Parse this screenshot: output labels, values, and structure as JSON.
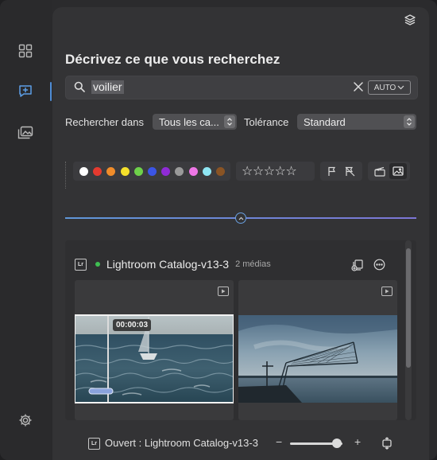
{
  "search": {
    "title": "Décrivez ce que vous recherchez",
    "query": "voilier",
    "auto_label": "AUTO"
  },
  "filters": {
    "search_in_label": "Rechercher dans",
    "search_in_value": "Tous les ca...",
    "tolerance_label": "Tolérance",
    "tolerance_value": "Standard",
    "colors": [
      "#ffffff",
      "#e53a2f",
      "#f08c2a",
      "#f5e02b",
      "#6ed14a",
      "#3b55e6",
      "#8f2bd6",
      "#9a9a9a",
      "#ee77e6",
      "#8fe6f3",
      "#8a5424"
    ],
    "stars": [
      "☆",
      "☆",
      "☆",
      "☆",
      "☆"
    ]
  },
  "results": {
    "catalog_badge": "Lr",
    "catalog_name": "Lightroom Catalog-v13-3",
    "media_count": "2 médias",
    "items": [
      {
        "timecode": "00:00:03",
        "kind": "video"
      },
      {
        "kind": "video"
      }
    ]
  },
  "footer": {
    "badge": "Lr",
    "open_label": "Ouvert : Lightroom Catalog-v13-3",
    "minus": "−",
    "plus": "+",
    "zoom_level": 0.9
  }
}
